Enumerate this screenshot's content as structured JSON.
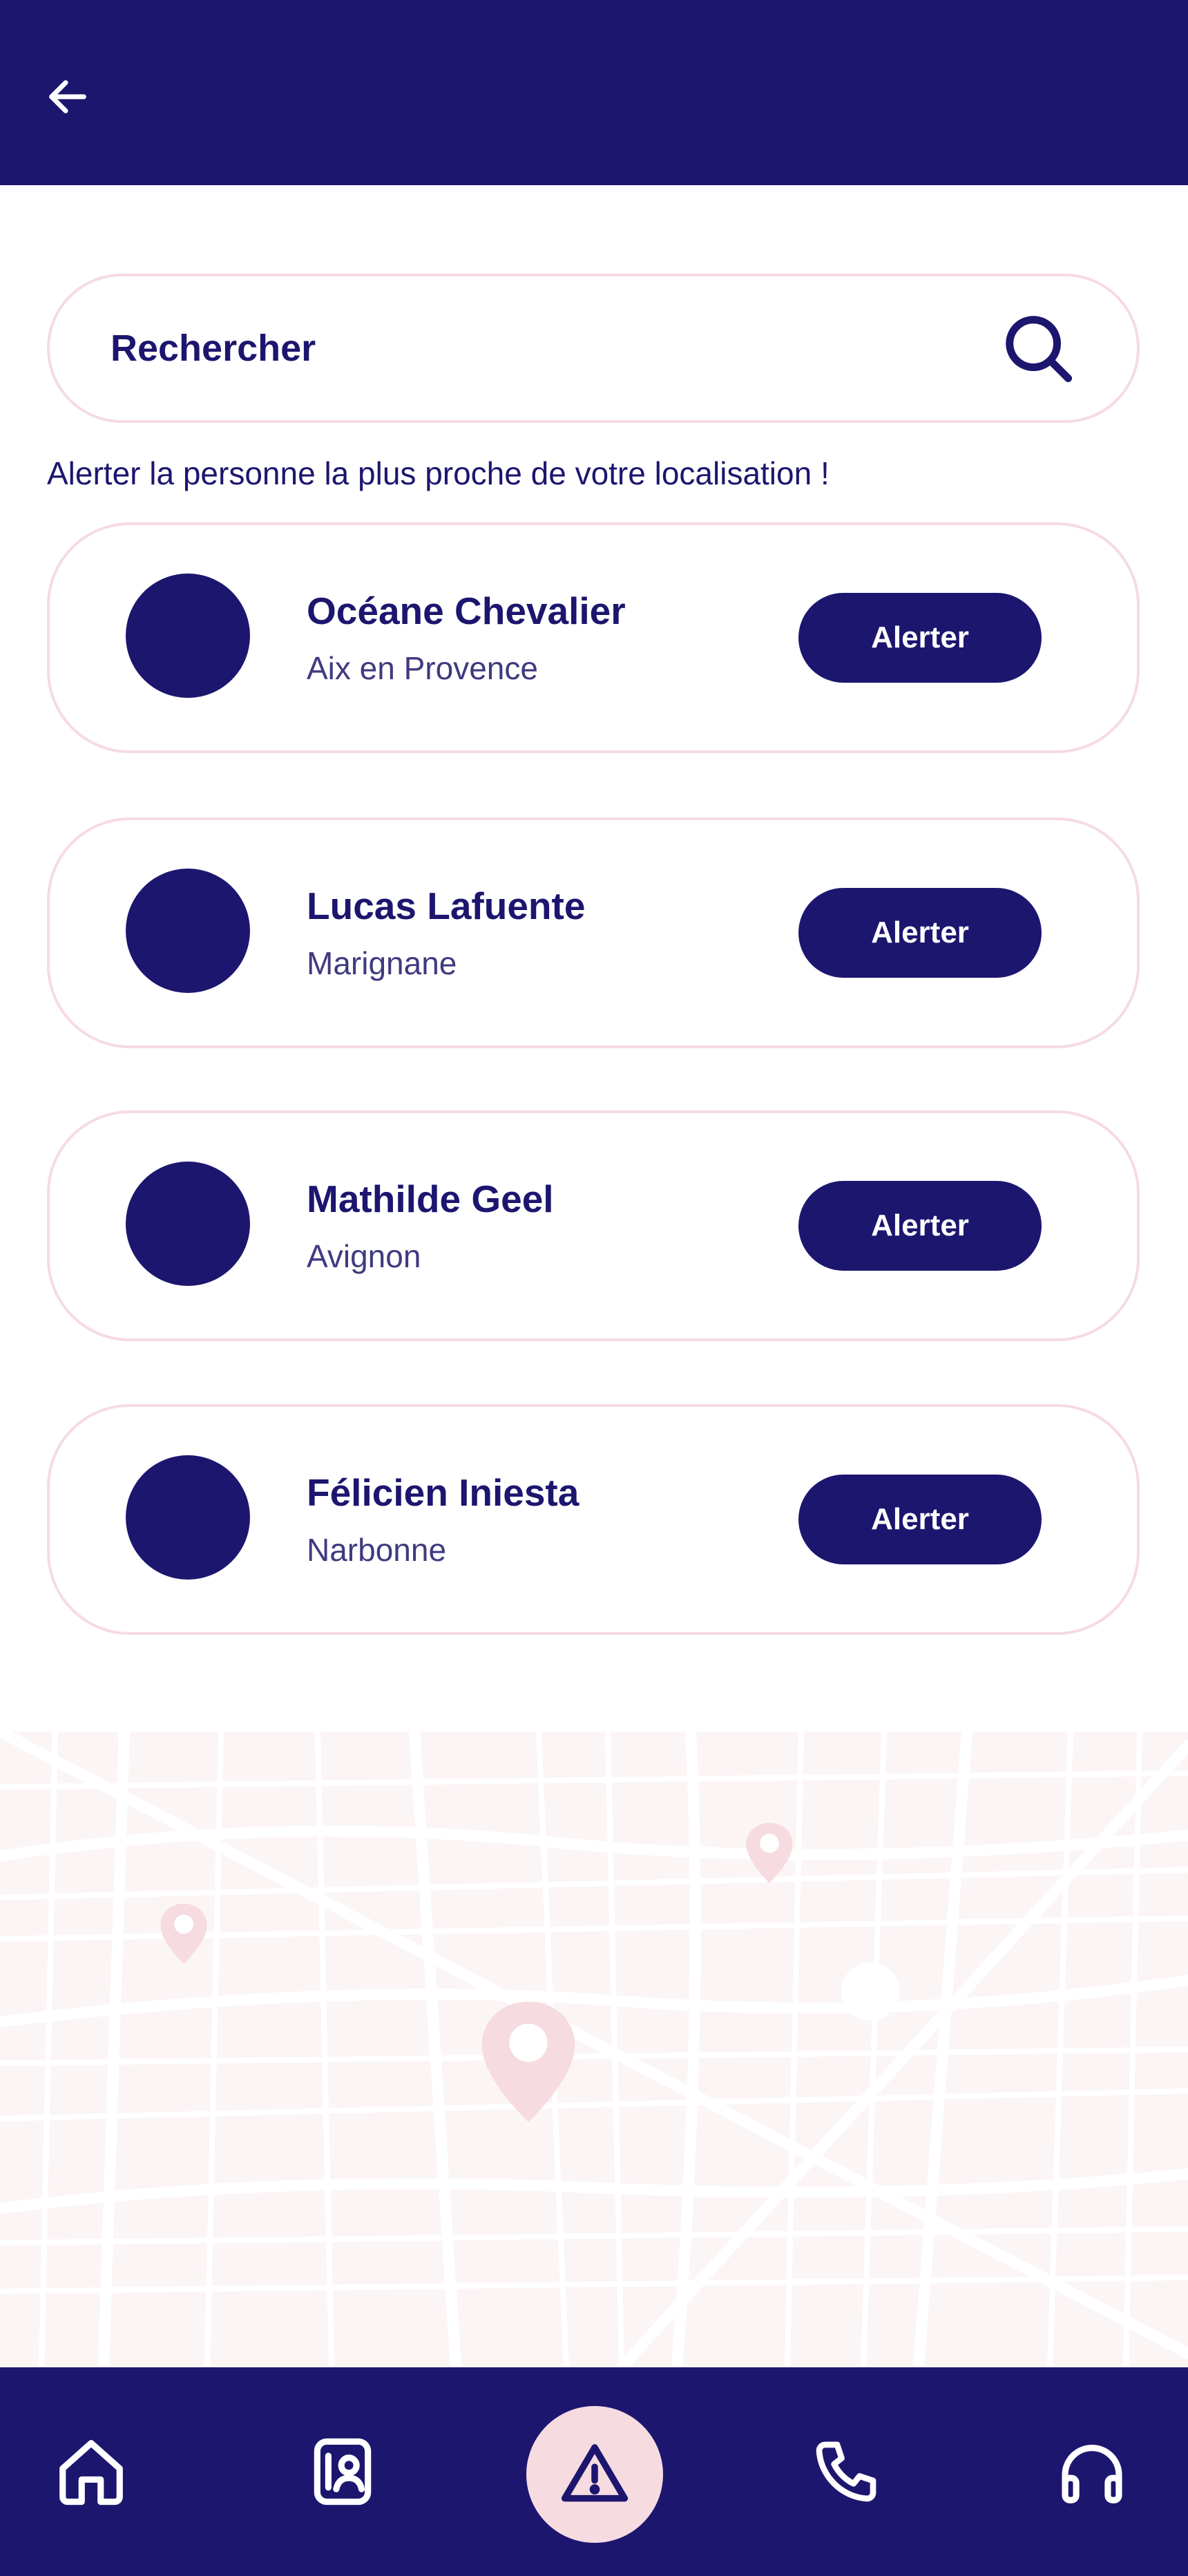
{
  "search": {
    "placeholder": "Rechercher"
  },
  "hint": "Alerter la personne la plus proche de votre localisation !",
  "contacts": [
    {
      "name": "Océane Chevalier",
      "city": "Aix en Provence",
      "button": "Alerter"
    },
    {
      "name": "Lucas Lafuente",
      "city": "Marignane",
      "button": "Alerter"
    },
    {
      "name": "Mathilde Geel",
      "city": "Avignon",
      "button": "Alerter"
    },
    {
      "name": "Félicien Iniesta",
      "city": "Narbonne",
      "button": "Alerter"
    }
  ],
  "colors": {
    "primary": "#1c166f",
    "accent_pink": "#f6dbe1",
    "map_background": "#fcf5f6"
  },
  "icons": {
    "header": "back-arrow-icon",
    "search": "search-icon",
    "nav": [
      "home-icon",
      "contacts-icon",
      "warning-icon",
      "phone-icon",
      "headphones-icon"
    ]
  }
}
